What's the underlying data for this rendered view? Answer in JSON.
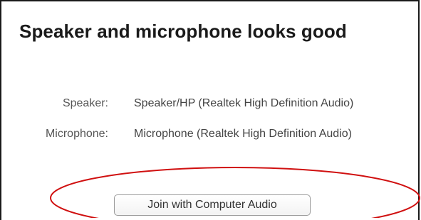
{
  "dialog": {
    "heading": "Speaker and microphone looks good",
    "speaker": {
      "label": "Speaker:",
      "value": "Speaker/HP (Realtek High Definition Audio)"
    },
    "microphone": {
      "label": "Microphone:",
      "value": "Microphone (Realtek High Definition Audio)"
    },
    "join_button_label": "Join with Computer Audio"
  },
  "colors": {
    "annotation_ellipse": "#d01010",
    "panel_border": "#1a1a1a",
    "heading_text": "#1a1a1a"
  }
}
